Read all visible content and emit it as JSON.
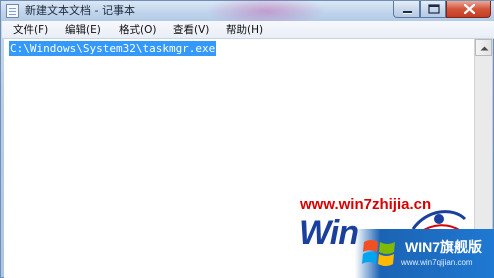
{
  "window": {
    "title": "新建文本文档 - 记事本",
    "icon": "notepad-icon",
    "controls": [
      "minimize-icon",
      "maximize-icon",
      "close-icon"
    ]
  },
  "menu": {
    "items": [
      {
        "label": "文件(F)"
      },
      {
        "label": "编辑(E)"
      },
      {
        "label": "格式(O)"
      },
      {
        "label": "查看(V)"
      },
      {
        "label": "帮助(H)"
      }
    ]
  },
  "editor": {
    "text": "C:\\Windows\\System32\\taskmgr.exe",
    "selected": true,
    "selection_color": "#3399ff"
  },
  "scrollbar": {
    "up_arrow_icon": "chevron-up-icon"
  },
  "watermark": {
    "url": "www.win7zhijia.cn",
    "logo_text": "Win",
    "badge_text": "WIN7旗舰版",
    "badge_sub": "www.win7qijian.com",
    "brand_color": "#1a3f9c",
    "url_color": "#d80000"
  }
}
